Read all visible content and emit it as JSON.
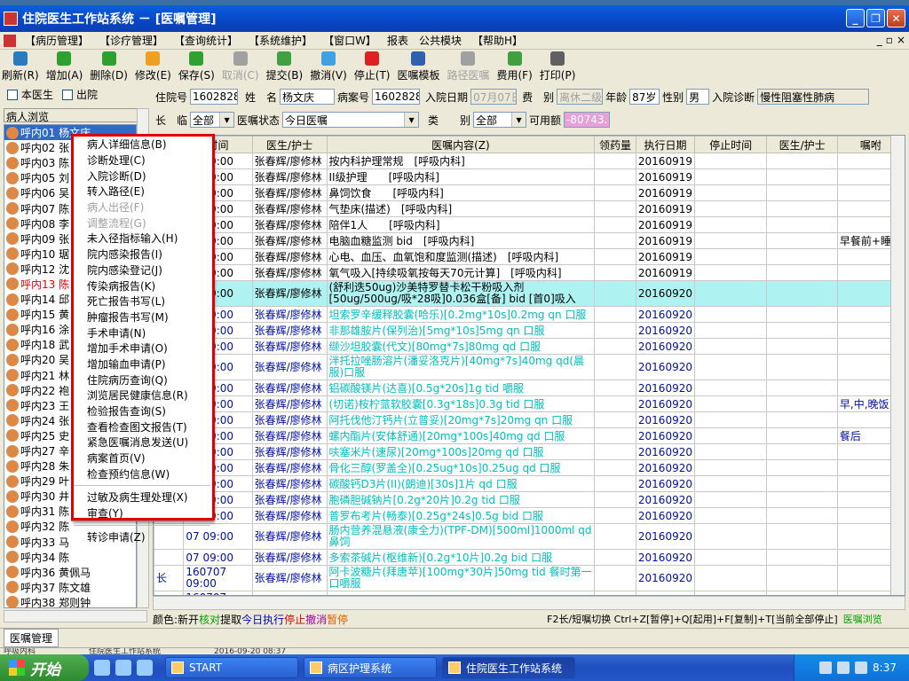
{
  "window": {
    "title": "住院医生工作站系统 － [医嘱管理]"
  },
  "menu": [
    "【病历管理】",
    "【诊疗管理】",
    "【查询统计】",
    "【系统维护】",
    "【窗口W】",
    "报表",
    "公共模块",
    "【帮助H】"
  ],
  "mdi_controls": [
    "_",
    "▫",
    "×"
  ],
  "toolbar": [
    {
      "label": "刷新(R)",
      "icon": "refresh-icon",
      "color": "#2a7abf",
      "enabled": true
    },
    {
      "label": "增加(A)",
      "icon": "add-icon",
      "color": "#2fa02f",
      "enabled": true
    },
    {
      "label": "删除(D)",
      "icon": "delete-icon",
      "color": "#2fa02f",
      "enabled": true
    },
    {
      "label": "修改(E)",
      "icon": "edit-icon",
      "color": "#f0a020",
      "enabled": true
    },
    {
      "label": "保存(S)",
      "icon": "save-icon",
      "color": "#30a030",
      "enabled": true
    },
    {
      "label": "取消(C)",
      "icon": "cancel-icon",
      "color": "#a0a0a0",
      "enabled": false
    },
    {
      "label": "提交(B)",
      "icon": "submit-icon",
      "color": "#40a040",
      "enabled": true
    },
    {
      "label": "撤消(V)",
      "icon": "undo-icon",
      "color": "#40a0e0",
      "enabled": true
    },
    {
      "label": "停止(T)",
      "icon": "stop-icon",
      "color": "#e02020",
      "enabled": true
    },
    {
      "label": "医嘱模板",
      "icon": "template-icon",
      "color": "#3060b0",
      "enabled": true
    },
    {
      "label": "路径医嘱",
      "icon": "path-icon",
      "color": "#a0a0a0",
      "enabled": false
    },
    {
      "label": "费用(F)",
      "icon": "fee-icon",
      "color": "#40a040",
      "enabled": true
    },
    {
      "label": "打印(P)",
      "icon": "print-icon",
      "color": "#606060",
      "enabled": true
    }
  ],
  "left": {
    "check_doctor": "本医生",
    "check_discharged": "出院",
    "list_header": "病人浏览",
    "patients": [
      {
        "label": "呼内01 杨文庆",
        "selected": true,
        "red": false
      },
      {
        "label": "呼内02 张",
        "selected": false,
        "red": false
      },
      {
        "label": "呼内03 陈",
        "selected": false,
        "red": false
      },
      {
        "label": "呼内05 刘",
        "selected": false,
        "red": false
      },
      {
        "label": "呼内06 吴",
        "selected": false,
        "red": false
      },
      {
        "label": "呼内07 陈",
        "selected": false,
        "red": false
      },
      {
        "label": "呼内08 李",
        "selected": false,
        "red": false
      },
      {
        "label": "呼内09 张",
        "selected": false,
        "red": false
      },
      {
        "label": "呼内10 琚",
        "selected": false,
        "red": false
      },
      {
        "label": "呼内12 沈",
        "selected": false,
        "red": false
      },
      {
        "label": "呼内13 陈",
        "selected": false,
        "red": true
      },
      {
        "label": "呼内14 邱",
        "selected": false,
        "red": false
      },
      {
        "label": "呼内15 黄",
        "selected": false,
        "red": false
      },
      {
        "label": "呼内16 涂",
        "selected": false,
        "red": false
      },
      {
        "label": "呼内18 武",
        "selected": false,
        "red": false
      },
      {
        "label": "呼内20 吴",
        "selected": false,
        "red": false
      },
      {
        "label": "呼内21 林",
        "selected": false,
        "red": false
      },
      {
        "label": "呼内22 袍",
        "selected": false,
        "red": false
      },
      {
        "label": "呼内23 王",
        "selected": false,
        "red": false
      },
      {
        "label": "呼内24 张",
        "selected": false,
        "red": false
      },
      {
        "label": "呼内25 史",
        "selected": false,
        "red": false
      },
      {
        "label": "呼内27 辛",
        "selected": false,
        "red": false
      },
      {
        "label": "呼内28 朱",
        "selected": false,
        "red": false
      },
      {
        "label": "呼内29 叶",
        "selected": false,
        "red": false
      },
      {
        "label": "呼内30 井",
        "selected": false,
        "red": false
      },
      {
        "label": "呼内31 陈",
        "selected": false,
        "red": false
      },
      {
        "label": "呼内32 陈",
        "selected": false,
        "red": false
      },
      {
        "label": "呼内33 马",
        "selected": false,
        "red": false
      },
      {
        "label": "呼内34 陈",
        "selected": false,
        "red": false
      },
      {
        "label": "呼内36 黄佩马",
        "selected": false,
        "red": false
      },
      {
        "label": "呼内37 陈文雄",
        "selected": false,
        "red": false
      },
      {
        "label": "呼内38 郑则钟",
        "selected": false,
        "red": false
      },
      {
        "label": "呼内39 朱冶",
        "selected": false,
        "red": false
      }
    ]
  },
  "form": {
    "bed_label": "住院号",
    "bed_value": "1602828",
    "name_label": "姓　名",
    "name_value": "杨文庆",
    "case_label": "病案号",
    "case_value": "1602828",
    "admit_label": "入院日期",
    "admit_value": "07月07日",
    "fee_label": "费　别",
    "fee_value": "离休二级",
    "age_label": "年龄",
    "age_value": "87岁",
    "sex_label": "性别",
    "sex_value": "男",
    "diag_label": "入院诊断",
    "diag_value": "慢性阻塞性肺病",
    "longtemp_label": "长　临",
    "longtemp_value": "全部",
    "status_label": "医嘱状态",
    "status_value": "今日医嘱",
    "type_label": "类　　别",
    "type_value": "全部",
    "avail_label": "可用额",
    "avail_value": "-80743.1"
  },
  "grid": {
    "headers": [
      "",
      "时间",
      "医生/护士",
      "医嘱内容(Z)",
      "领药量",
      "执行日期",
      "停止时间",
      "医生/护士",
      "嘱咐"
    ],
    "rows": [
      {
        "c0": "",
        "time": "07 09:00",
        "doc": "张春辉/廖修林",
        "content": "按内科护理常规　[呼吸内科]",
        "qty": "",
        "exec": "20160919",
        "stop": "",
        "doc2": "",
        "note": "",
        "style": ""
      },
      {
        "c0": "",
        "time": "07 09:00",
        "doc": "张春辉/廖修林",
        "content": "II级护理　　[呼吸内科]",
        "qty": "",
        "exec": "20160919",
        "stop": "",
        "doc2": "",
        "note": "",
        "style": ""
      },
      {
        "c0": "",
        "time": "07 09:00",
        "doc": "张春辉/廖修林",
        "content": "鼻饲饮食　　[呼吸内科]",
        "qty": "",
        "exec": "20160919",
        "stop": "",
        "doc2": "",
        "note": "",
        "style": ""
      },
      {
        "c0": "",
        "time": "07 09:00",
        "doc": "张春辉/廖修林",
        "content": "气垫床(描述)　[呼吸内科]",
        "qty": "",
        "exec": "20160919",
        "stop": "",
        "doc2": "",
        "note": "",
        "style": ""
      },
      {
        "c0": "",
        "time": "07 09:00",
        "doc": "张春辉/廖修林",
        "content": "陪伴1人　　[呼吸内科]",
        "qty": "",
        "exec": "20160919",
        "stop": "",
        "doc2": "",
        "note": "",
        "style": ""
      },
      {
        "c0": "",
        "time": "07 09:00",
        "doc": "张春辉/廖修林",
        "content": "电脑血糖监测 bid　[呼吸内科]",
        "qty": "",
        "exec": "20160919",
        "stop": "",
        "doc2": "",
        "note": "早餐前+睡前",
        "style": ""
      },
      {
        "c0": "",
        "time": "07 09:00",
        "doc": "张春辉/廖修林",
        "content": "心电、血压、血氧饱和度监测(描述)　[呼吸内科]",
        "qty": "",
        "exec": "20160919",
        "stop": "",
        "doc2": "",
        "note": "",
        "style": ""
      },
      {
        "c0": "",
        "time": "07 09:00",
        "doc": "张春辉/廖修林",
        "content": "氧气吸入[持续吸氧按每天70元计算]　[呼吸内科]",
        "qty": "",
        "exec": "20160919",
        "stop": "",
        "doc2": "",
        "note": "",
        "style": ""
      },
      {
        "c0": "",
        "time": "07 09:00",
        "doc": "张春辉/廖修林",
        "content": "(舒利迭50ug)沙美特罗替卡松干粉吸入剂[50ug/500ug/吸*28吸]0.036盒[备] bid [首0]吸入",
        "qty": "",
        "exec": "20160920",
        "stop": "",
        "doc2": "",
        "note": "",
        "style": "hl tall"
      },
      {
        "c0": "",
        "time": "07 09:00",
        "doc": "张春辉/廖修林",
        "content": "坦索罗辛缓释胶囊(哈乐)[0.2mg*10s]0.2mg qn 口服",
        "qty": "",
        "exec": "20160920",
        "stop": "",
        "doc2": "",
        "note": "",
        "style": "blue"
      },
      {
        "c0": "",
        "time": "07 09:00",
        "doc": "张春辉/廖修林",
        "content": "非那雄胺片(保列治)[5mg*10s]5mg qn 口服",
        "qty": "",
        "exec": "20160920",
        "stop": "",
        "doc2": "",
        "note": "",
        "style": "blue"
      },
      {
        "c0": "",
        "time": "07 09:00",
        "doc": "张春辉/廖修林",
        "content": "缬沙坦胶囊(代文)[80mg*7s]80mg qd 口服",
        "qty": "",
        "exec": "20160920",
        "stop": "",
        "doc2": "",
        "note": "",
        "style": "blue"
      },
      {
        "c0": "",
        "time": "07 09:00",
        "doc": "张春辉/廖修林",
        "content": "泮托拉唑肠溶片(潘妥洛克片)[40mg*7s]40mg qd(晨服)口服",
        "qty": "",
        "exec": "20160920",
        "stop": "",
        "doc2": "",
        "note": "",
        "style": "blue tall"
      },
      {
        "c0": "",
        "time": "07 09:00",
        "doc": "张春辉/廖修林",
        "content": "铝碳酸镁片(达喜)[0.5g*20s]1g tid 嚼服",
        "qty": "",
        "exec": "20160920",
        "stop": "",
        "doc2": "",
        "note": "",
        "style": "blue"
      },
      {
        "c0": "",
        "time": "07 09:00",
        "doc": "张春辉/廖修林",
        "content": "(切诺)桉柠蒎软胶囊[0.3g*18s]0.3g tid 口服",
        "qty": "",
        "exec": "20160920",
        "stop": "",
        "doc2": "",
        "note": "早,中,晚饭",
        "style": "blue"
      },
      {
        "c0": "",
        "time": "07 09:00",
        "doc": "张春辉/廖修林",
        "content": "阿托伐他汀钙片(立普妥)[20mg*7s]20mg qn 口服",
        "qty": "",
        "exec": "20160920",
        "stop": "",
        "doc2": "",
        "note": "",
        "style": "blue"
      },
      {
        "c0": "",
        "time": "07 09:00",
        "doc": "张春辉/廖修林",
        "content": "螺内酯片(安体舒通)[20mg*100s]40mg qd 口服",
        "qty": "",
        "exec": "20160920",
        "stop": "",
        "doc2": "",
        "note": "餐后",
        "style": "blue"
      },
      {
        "c0": "",
        "time": "07 09:00",
        "doc": "张春辉/廖修林",
        "content": "呋塞米片(速尿)[20mg*100s]20mg qd 口服",
        "qty": "",
        "exec": "20160920",
        "stop": "",
        "doc2": "",
        "note": "",
        "style": "blue"
      },
      {
        "c0": "",
        "time": "07 09:00",
        "doc": "张春辉/廖修林",
        "content": "骨化三醇(罗盖全)[0.25ug*10s]0.25ug qd 口服",
        "qty": "",
        "exec": "20160920",
        "stop": "",
        "doc2": "",
        "note": "",
        "style": "blue"
      },
      {
        "c0": "",
        "time": "07 09:00",
        "doc": "张春辉/廖修林",
        "content": "碳酸钙D3片(II)(朗迪)[30s]1片 qd 口服",
        "qty": "",
        "exec": "20160920",
        "stop": "",
        "doc2": "",
        "note": "",
        "style": "blue"
      },
      {
        "c0": "",
        "time": "07 09:00",
        "doc": "张春辉/廖修林",
        "content": "胞磷胆碱钠片[0.2g*20片]0.2g tid 口服",
        "qty": "",
        "exec": "20160920",
        "stop": "",
        "doc2": "",
        "note": "",
        "style": "blue"
      },
      {
        "c0": "",
        "time": "07 09:00",
        "doc": "张春辉/廖修林",
        "content": "普罗布考片(畅泰)[0.25g*24s]0.5g bid 口服",
        "qty": "",
        "exec": "20160920",
        "stop": "",
        "doc2": "",
        "note": "",
        "style": "blue"
      },
      {
        "c0": "",
        "time": "07 09:00",
        "doc": "张春辉/廖修林",
        "content": "肠内营养混悬液(康全力)(TPF-DM)[500ml]1000ml qd 鼻饲",
        "qty": "",
        "exec": "20160920",
        "stop": "",
        "doc2": "",
        "note": "",
        "style": "blue tall"
      },
      {
        "c0": "",
        "time": "07 09:00",
        "doc": "张春辉/廖修林",
        "content": "多索茶碱片(枢维新)[0.2g*10片]0.2g bid 口服",
        "qty": "",
        "exec": "20160920",
        "stop": "",
        "doc2": "",
        "note": "",
        "style": "blue"
      },
      {
        "c0": "长",
        "time": "160707 09:00",
        "doc": "张春辉/廖修林",
        "content": "阿卡波糖片(拜唐苹)[100mg*30片]50mg tid 餐时第一口嚼服",
        "qty": "",
        "exec": "20160920",
        "stop": "",
        "doc2": "",
        "note": "",
        "style": "blue tall"
      },
      {
        "c0": "长",
        "time": "160707 09:00",
        "doc": "张春辉/廖修林",
        "content": "噻托溴铵(思力华)粉吸入剂(不含吸入装置)[18ug*1",
        "qty": "",
        "exec": "20160920",
        "stop": "",
        "doc2": "",
        "note": "",
        "style": "blue tall"
      }
    ]
  },
  "legend": {
    "prefix": "颜色:",
    "new": "新开",
    "check": "核对",
    "fetch": "提取",
    "today": "今日执行",
    "stop": "停止",
    "cancel": "撤消",
    "pause": "暂停",
    "help": "F2长/短嘱切换 Ctrl+Z[暂停]+Q[起用]+F[复制]+T[当前全部停止]",
    "browse": "医嘱浏览"
  },
  "context_menu": {
    "items_a": [
      {
        "label": "病人详细信息(B)",
        "enabled": true
      },
      {
        "label": "诊断处理(C)",
        "enabled": true
      },
      {
        "label": "入院诊断(D)",
        "enabled": true
      },
      {
        "label": "转入路径(E)",
        "enabled": true
      },
      {
        "label": "病人出径(F)",
        "enabled": false
      },
      {
        "label": "调整流程(G)",
        "enabled": false
      },
      {
        "label": "未入径指标输入(H)",
        "enabled": true
      },
      {
        "label": "院内感染报告(I)",
        "enabled": true
      },
      {
        "label": "院内感染登记(J)",
        "enabled": true
      },
      {
        "label": "传染病报告(K)",
        "enabled": true
      },
      {
        "label": "死亡报告书写(L)",
        "enabled": true
      },
      {
        "label": "肿瘤报告书写(M)",
        "enabled": true
      },
      {
        "label": "手术申请(N)",
        "enabled": true
      },
      {
        "label": "增加手术申请(O)",
        "enabled": true
      },
      {
        "label": "增加输血申请(P)",
        "enabled": true
      },
      {
        "label": "住院病历查询(Q)",
        "enabled": true
      },
      {
        "label": "浏览居民健康信息(R)",
        "enabled": true
      },
      {
        "label": "检验报告查询(S)",
        "enabled": true
      },
      {
        "label": "查看检查图文报告(T)",
        "enabled": true
      },
      {
        "label": "紧急医嘱消息发送(U)",
        "enabled": true
      },
      {
        "label": "病案首页(V)",
        "enabled": true
      },
      {
        "label": "检查预约信息(W)",
        "enabled": true
      }
    ],
    "items_b": [
      {
        "label": "过敏及病生理处理(X)",
        "enabled": true
      },
      {
        "label": "审查(Y)",
        "enabled": true
      }
    ],
    "items_c": [
      {
        "label": "转诊申请(Z)",
        "enabled": true
      }
    ]
  },
  "status": {
    "tab": "医嘱管理",
    "info1": "呼吸内科",
    "info2": "住院医生工作站系统",
    "info3": "2016-09-20 08:37"
  },
  "taskbar": {
    "start": "开始",
    "tasks": [
      {
        "label": "START",
        "active": false
      },
      {
        "label": "病区护理系统",
        "active": false
      },
      {
        "label": "住院医生工作站系统",
        "active": true
      }
    ],
    "time": "8:37"
  }
}
